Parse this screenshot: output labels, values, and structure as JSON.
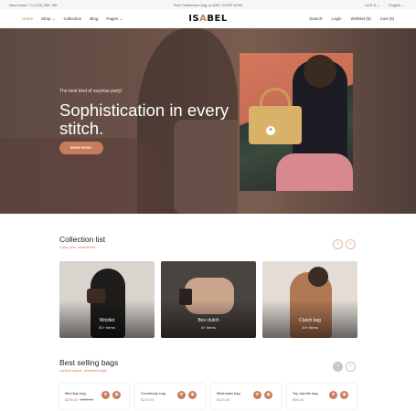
{
  "topbar": {
    "help": "Need help? +1 (123) 456 789",
    "promo": "Free Fallowears bag on $45+ SHOP NOW",
    "currency": "AUD $ ⌄",
    "language": "English ⌄"
  },
  "nav": {
    "links": [
      {
        "label": "Home"
      },
      {
        "label": "Shop ⌄"
      },
      {
        "label": "Collection"
      },
      {
        "label": "Blog"
      },
      {
        "label": "Pages ⌄"
      }
    ],
    "logo_left": "IS",
    "logo_mid": "A",
    "logo_right": "BEL",
    "right_links": [
      {
        "label": "Search"
      },
      {
        "label": "Login"
      },
      {
        "label": "Wishlist (0)"
      },
      {
        "label": "Cart (0)"
      }
    ]
  },
  "hero": {
    "tagline": "The best kind of surprise party!",
    "headline": "Sophistication in every stitch.",
    "button": "SHOP NOW ›",
    "plus_icon": "+"
  },
  "collection": {
    "title": "Collection list",
    "subtitle": "Carry your confidence",
    "prev": "‹",
    "next": "›",
    "cards": [
      {
        "title": "Wristlet",
        "count": "51+ Items"
      },
      {
        "title": "Box clutch",
        "count": "8+ Items"
      },
      {
        "title": "Clutch bag",
        "count": "10+ Items"
      }
    ]
  },
  "bestselling": {
    "title": "Best selling bags",
    "subtitle": "Limited space, unlimited style",
    "prev": "‹",
    "next": "›",
    "products": [
      {
        "name": "Mini flap bag",
        "price": "$255.00",
        "old_price": "$295.00"
      },
      {
        "name": "Crossbody bag",
        "price": "$219.00",
        "old_price": ""
      },
      {
        "name": "Minimalist bag",
        "price": "$120.00",
        "old_price": ""
      },
      {
        "name": "Top-handle bag",
        "price": "$96.00",
        "old_price": ""
      }
    ],
    "icons": {
      "cart": "⊕",
      "eye": "◉"
    }
  },
  "colors": {
    "accent": "#c87d5a"
  }
}
